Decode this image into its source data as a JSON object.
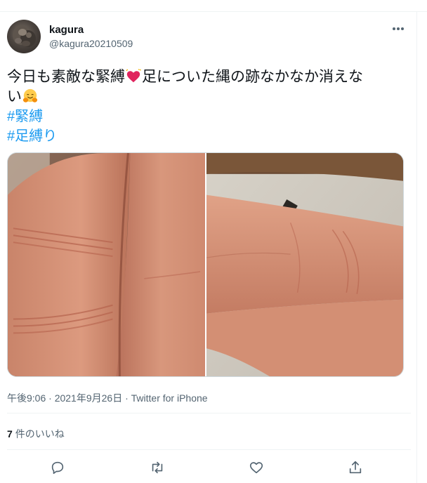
{
  "user": {
    "display_name": "kagura",
    "handle": "@kagura20210509"
  },
  "tweet": {
    "text_line1": "今日も素敵な緊縛",
    "text_line1_b": "足についた縄の跡なかなか消えな",
    "text_line2": "い",
    "hashtags": [
      "#緊縛",
      "#足縛り"
    ],
    "meta": "午後9:06 · 2021年9月26日 · Twitter for iPhone"
  },
  "engagement": {
    "likes_count": "7",
    "likes_label": "件のいいね"
  },
  "icons": {
    "more": "more-icon",
    "reply": "reply-icon",
    "retweet": "retweet-icon",
    "like": "like-icon",
    "share": "share-icon",
    "emoji_heart": "sparkling-heart-emoji",
    "emoji_hug": "hugging-face-emoji"
  },
  "colors": {
    "link": "#1d9bf0",
    "secondary": "#536471",
    "text": "#0f1419",
    "rule": "#eff3f4"
  }
}
